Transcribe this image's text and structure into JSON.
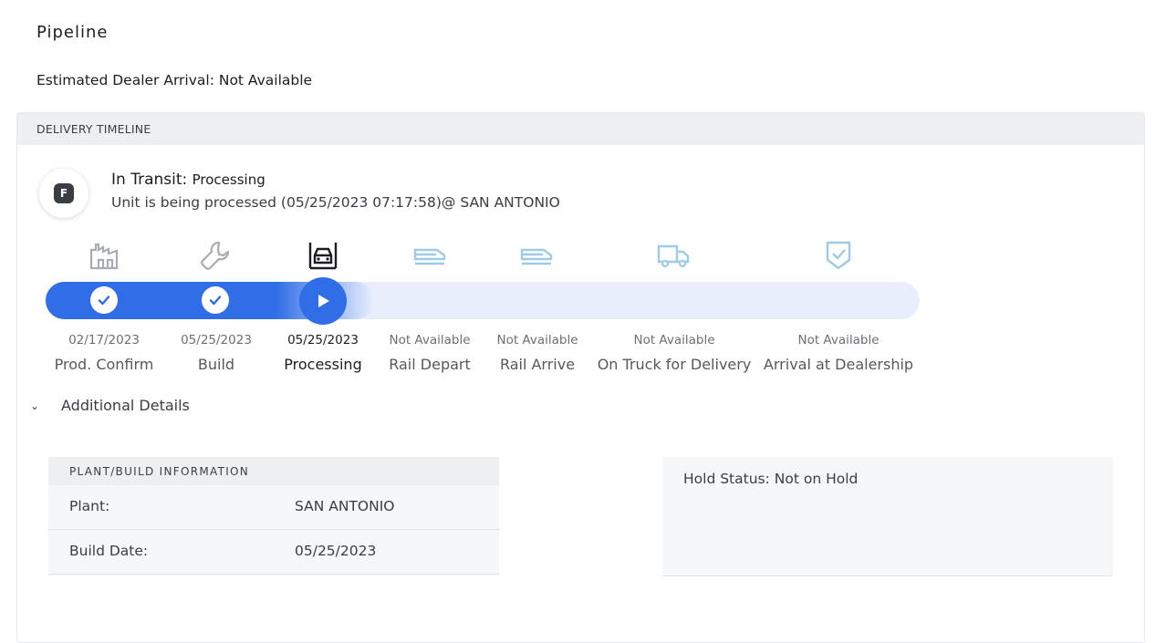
{
  "page": {
    "title": "Pipeline",
    "eta": "Estimated Dealer Arrival: Not Available"
  },
  "timeline": {
    "header": "DELIVERY TIMELINE",
    "status": {
      "avatar_letter": "F",
      "title": "In Transit:",
      "subtitle": "Processing",
      "description": "Unit is being processed (05/25/2023 07:17:58)@ SAN ANTONIO"
    },
    "progress": {
      "completed_steps": 2,
      "current_step": 3,
      "total_steps": 7
    },
    "steps": [
      {
        "date": "02/17/2023",
        "label": "Prod. Confirm",
        "state": "complete",
        "icon": "factory-icon"
      },
      {
        "date": "05/25/2023",
        "label": "Build",
        "state": "complete",
        "icon": "wrench-icon"
      },
      {
        "date": "05/25/2023",
        "label": "Processing",
        "state": "current",
        "icon": "vehicle-lift-icon"
      },
      {
        "date": "Not Available",
        "label": "Rail Depart",
        "state": "pending",
        "icon": "rail-car-icon"
      },
      {
        "date": "Not Available",
        "label": "Rail Arrive",
        "state": "pending",
        "icon": "rail-car-icon"
      },
      {
        "date": "Not Available",
        "label": "On Truck for Delivery",
        "state": "pending",
        "icon": "truck-icon"
      },
      {
        "date": "Not Available",
        "label": "Arrival at Dealership",
        "state": "pending",
        "icon": "shield-check-icon"
      }
    ],
    "colors": {
      "progress": "#2f6ee6",
      "track": "#e8eefc",
      "pending_icon": "#9fcbe6",
      "done_icon": "#a9acb2"
    }
  },
  "details": {
    "toggle_label": "Additional Details",
    "plant": {
      "header": "PLANT/BUILD INFORMATION",
      "rows": [
        {
          "key": "Plant:",
          "value": "SAN ANTONIO"
        },
        {
          "key": "Build Date:",
          "value": "05/25/2023"
        }
      ]
    },
    "hold": {
      "text": "Hold Status: Not on Hold"
    }
  }
}
